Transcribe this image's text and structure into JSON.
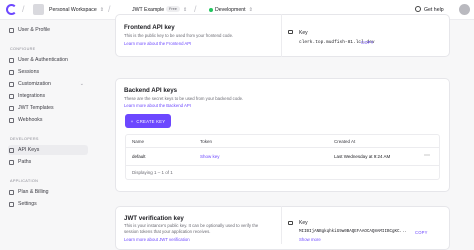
{
  "topbar": {
    "workspace": "Personal Workspace",
    "app": "JWT Example",
    "plan_badge": "Free",
    "environment": "Development",
    "help": "Get help"
  },
  "sidebar": {
    "top_items": [
      {
        "label": "User & Profile"
      }
    ],
    "configure_header": "CONFIGURE",
    "configure_items": [
      {
        "label": "User & Authentication"
      },
      {
        "label": "Sessions"
      },
      {
        "label": "Customization"
      },
      {
        "label": "Integrations"
      },
      {
        "label": "JWT Templates"
      },
      {
        "label": "Webhooks"
      }
    ],
    "developers_header": "DEVELOPERS",
    "developers_items": [
      {
        "label": "API Keys"
      },
      {
        "label": "Paths"
      }
    ],
    "application_header": "APPLICATION",
    "application_items": [
      {
        "label": "Plan & Billing"
      },
      {
        "label": "Settings"
      }
    ]
  },
  "frontend": {
    "title": "Frontend API key",
    "description": "This is the public key to be used from your frontend code.",
    "link": "Learn more about the Frontend API",
    "key_label": "Key",
    "key_value": "clerk.top.mudfish-81.lcl.dev",
    "copy": "COPY"
  },
  "backend": {
    "title": "Backend API keys",
    "description": "These are the secret keys to be used from your backend code.",
    "link": "Learn more about the Backend API",
    "create_button": "CREATE KEY",
    "table": {
      "headers": [
        "Name",
        "Token",
        "Created At"
      ],
      "rows": [
        {
          "name": "default",
          "token": "Show key",
          "created": "Last Wednesday at 9:24 AM"
        }
      ],
      "footer": "Displaying 1 – 1 of 1"
    }
  },
  "jwt": {
    "title": "JWT verification key",
    "description_line1": "This is your instance's public key. It can be optionally used to verify the",
    "description_line2": "session tokens that your application receives.",
    "link": "Learn more about JWT verification",
    "key_label": "Key",
    "key_value": "MIIBIjANBgkqhkiG9w0BAQEFAAOCAQ8AMIIBCgKC...",
    "copy": "COPY",
    "show_more": "Show more"
  },
  "colors": {
    "accent": "#6c47ff",
    "env": "#22c55e"
  }
}
